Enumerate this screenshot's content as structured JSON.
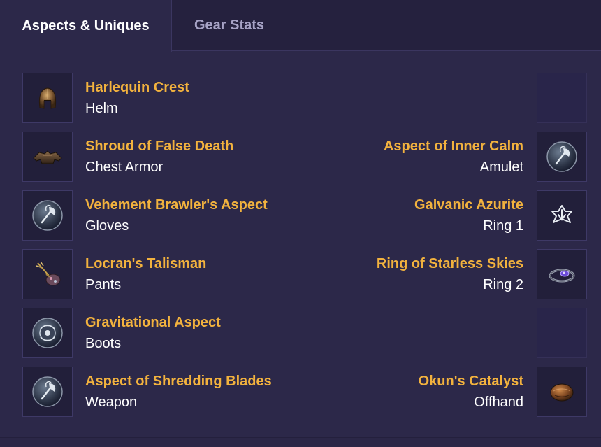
{
  "tabs": [
    {
      "label": "Aspects & Uniques",
      "active": true
    },
    {
      "label": "Gear Stats",
      "active": false
    }
  ],
  "left_items": [
    {
      "name": "Harlequin Crest",
      "slot": "Helm",
      "icon": "helm-icon"
    },
    {
      "name": "Shroud of False Death",
      "slot": "Chest Armor",
      "icon": "chest-armor-icon"
    },
    {
      "name": "Vehement Brawler's Aspect",
      "slot": "Gloves",
      "icon": "aspect-axe-icon"
    },
    {
      "name": "Locran's Talisman",
      "slot": "Pants",
      "icon": "talisman-icon"
    },
    {
      "name": "Gravitational Aspect",
      "slot": "Boots",
      "icon": "gravitational-aspect-icon"
    },
    {
      "name": "Aspect of Shredding Blades",
      "slot": "Weapon",
      "icon": "aspect-axe-icon"
    }
  ],
  "right_items": [
    {
      "empty": true
    },
    {
      "name": "Aspect of Inner Calm",
      "slot": "Amulet",
      "icon": "aspect-axe-icon"
    },
    {
      "name": "Galvanic Azurite",
      "slot": "Ring 1",
      "icon": "galvanic-sigil-icon"
    },
    {
      "name": "Ring of Starless Skies",
      "slot": "Ring 2",
      "icon": "ring-icon"
    },
    {
      "empty": true
    },
    {
      "name": "Okun's Catalyst",
      "slot": "Offhand",
      "icon": "catalyst-icon"
    }
  ],
  "colors": {
    "item_name": "#f2b23e",
    "slot_name": "#ffffff",
    "background": "#2c2849",
    "tab_bar": "#25213e"
  }
}
